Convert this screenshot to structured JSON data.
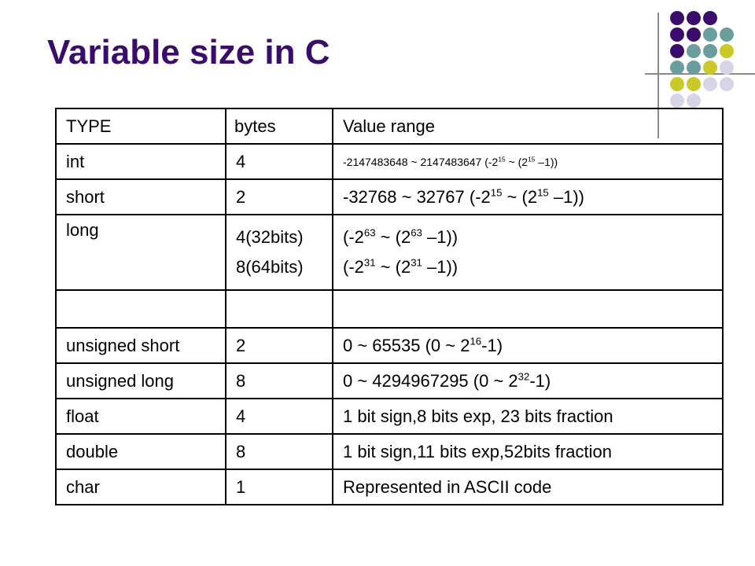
{
  "slide": {
    "title": "Variable size in C"
  },
  "decoration": {
    "dot_rows": [
      [
        "#3a0d6b",
        "#3a0d6b",
        "#3a0d6b"
      ],
      [
        "#3a0d6b",
        "#3a0d6b",
        "#6a9e9e",
        "#6a9e9e"
      ],
      [
        "#3a0d6b",
        "#6a9e9e",
        "#6a9e9e",
        "#c9c92a"
      ],
      [
        "#6a9e9e",
        "#6a9e9e",
        "#c9c92a",
        "#d5d5e6"
      ],
      [
        "#c9c92a",
        "#c9c92a",
        "#d5d5e6",
        "#d5d5e6"
      ],
      [
        "#d5d5e6",
        "#d5d5e6"
      ]
    ]
  },
  "table": {
    "headers": [
      "TYPE",
      "bytes",
      "Value range"
    ],
    "rows": {
      "int": {
        "type": "int",
        "bytes": "4",
        "range": "-2147483648 ~ 2147483647 (-2^15 ~ (2^15 –1))"
      },
      "short": {
        "type": "short",
        "bytes": "2",
        "range": "-32768 ~ 32767 (-2^15 ~ (2^15 –1))"
      },
      "long": {
        "type": "long",
        "bytes": [
          "4(32bits)",
          "8(64bits)"
        ],
        "range": [
          "(-2^63 ~ (2^63 –1))",
          "(-2^31 ~ (2^31 –1))"
        ]
      },
      "unsigned_short": {
        "type": "unsigned short",
        "bytes": "2",
        "range": "0 ~ 65535 (0 ~ 2^16-1)"
      },
      "unsigned_long": {
        "type": "unsigned long",
        "bytes": "8",
        "range": "0 ~ 4294967295 (0 ~ 2^32-1)"
      },
      "float": {
        "type": "float",
        "bytes": "4",
        "range": "1 bit sign,8 bits exp, 23 bits fraction"
      },
      "double": {
        "type": "double",
        "bytes": "8",
        "range": "1 bit sign,11 bits exp,52bits fraction"
      },
      "char": {
        "type": "char",
        "bytes": "1",
        "range": "Represented in ASCII code"
      }
    }
  }
}
